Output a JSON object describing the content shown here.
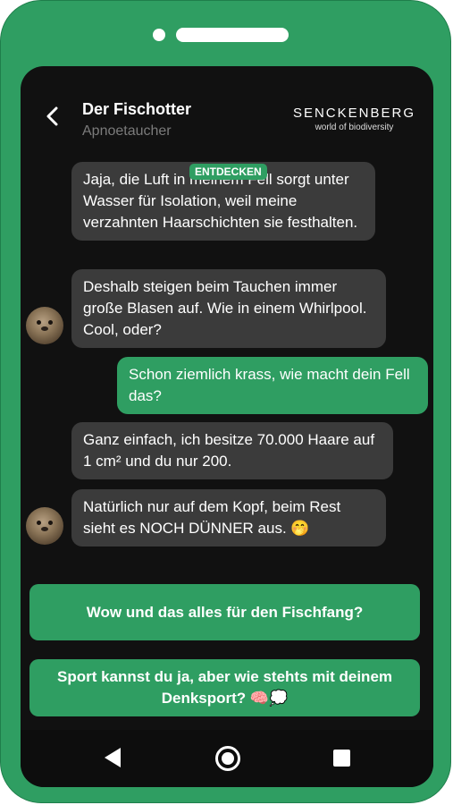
{
  "header": {
    "title": "Der Fischotter",
    "subtitle": "Apnoetaucher",
    "logo_main": "SENCKENBERG",
    "logo_sub": "world of biodiversity"
  },
  "badge": "ENTDECKEN",
  "messages": [
    {
      "sender": "otter",
      "text": "Jaja, die Luft in meinem Fell sorgt unter Wasser für Isolation, weil meine verzahnten Haarschichten sie festhalten."
    },
    {
      "sender": "otter",
      "text": "Deshalb steigen beim Tauchen immer große Blasen auf. Wie in einem Whirlpool. Cool, oder?"
    },
    {
      "sender": "user",
      "text": "Schon ziemlich krass, wie macht dein Fell das?"
    },
    {
      "sender": "otter",
      "text": "Ganz einfach, ich besitze 70.000 Haare auf 1 cm² und du nur 200."
    },
    {
      "sender": "otter",
      "text": "Natürlich nur auf dem Kopf, beim Rest sieht es NOCH DÜNNER aus.",
      "emoji": "🤭"
    }
  ],
  "choices": [
    {
      "text": "Wow und das alles für den Fischfang?"
    },
    {
      "text": "Sport kannst du ja, aber wie stehts mit deinem Denksport?",
      "emoji": "🧠💭"
    }
  ],
  "colors": {
    "frame": "#2f9e62",
    "screen": "#111111",
    "bubble_in": "#3b3b3b",
    "bubble_out": "#2f9e62"
  },
  "icons": {
    "back": "chevron-left-icon",
    "nav_back": "triangle-back-icon",
    "nav_home": "circle-home-icon",
    "nav_recent": "square-recent-icon"
  }
}
